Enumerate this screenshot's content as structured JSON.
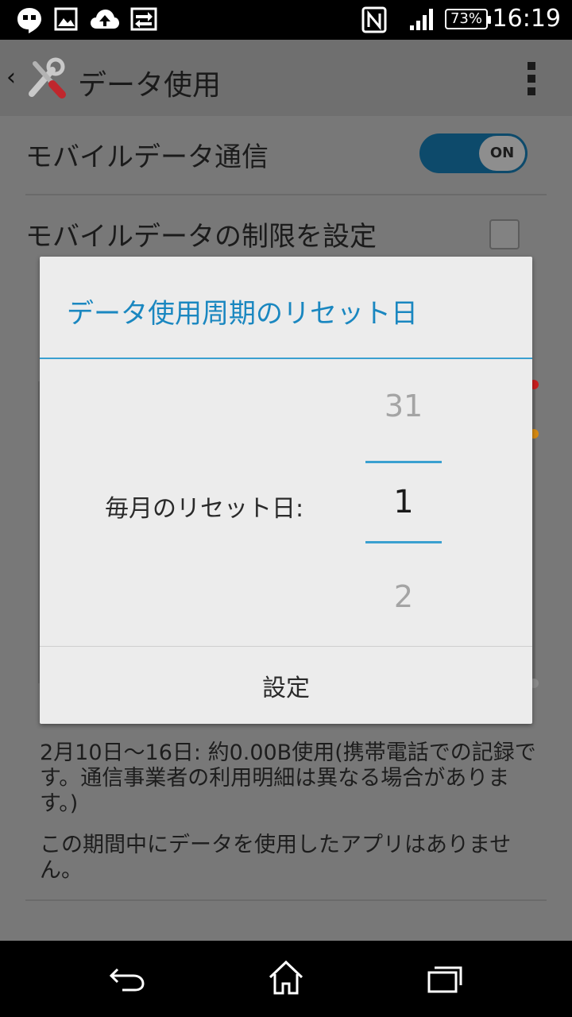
{
  "statusbar": {
    "battery": "73%",
    "time": "16:19",
    "icons": [
      "hangouts-icon",
      "image-icon",
      "cloud-upload-icon",
      "data-transfer-icon",
      "nfc-icon",
      "signal-icon",
      "battery-icon"
    ]
  },
  "actionbar": {
    "back": "‹",
    "title": "データ使用",
    "icons": [
      "settings-tools-icon",
      "overflow-menu-icon"
    ]
  },
  "settings": {
    "mobile_data_label": "モバイルデータ通信",
    "mobile_data_toggle": "ON",
    "limit_label": "モバイルデータの制限を設定"
  },
  "notes": {
    "usage": "2月10日～16日: 約0.00B使用(携帯電話での記録です。通信事業者の利用明細は異なる場合があります。)",
    "no_apps": "この期間中にデータを使用したアプリはありません。"
  },
  "dialog": {
    "title": "データ使用周期のリセット日",
    "label": "毎月のリセット日:",
    "picker_prev": "31",
    "picker_selected": "1",
    "picker_next": "2",
    "button": "設定"
  },
  "colors": {
    "accent": "#1a87c0",
    "toggle_track": "#0d4a6b",
    "warning_red": "#c81e1e",
    "warning_orange": "#d68a12"
  },
  "navbar": {
    "icons": [
      "back-icon",
      "home-icon",
      "recent-apps-icon"
    ]
  }
}
